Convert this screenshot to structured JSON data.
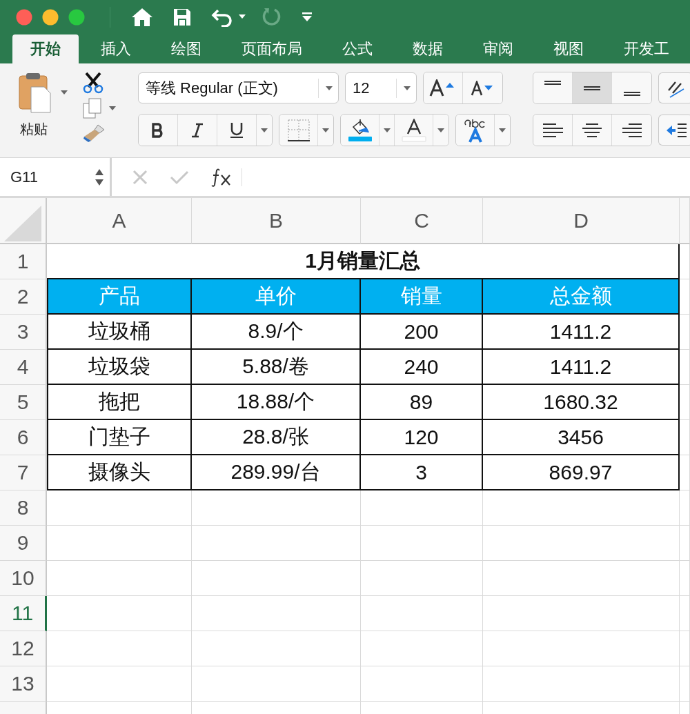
{
  "tabs": [
    {
      "label": "开始",
      "selected": true
    },
    {
      "label": "插入",
      "selected": false
    },
    {
      "label": "绘图",
      "selected": false
    },
    {
      "label": "页面布局",
      "selected": false
    },
    {
      "label": "公式",
      "selected": false
    },
    {
      "label": "数据",
      "selected": false
    },
    {
      "label": "审阅",
      "selected": false
    },
    {
      "label": "视图",
      "selected": false
    },
    {
      "label": "开发工",
      "selected": false
    }
  ],
  "ribbon": {
    "paste_label": "粘贴",
    "font_name": "等线 Regular (正文)",
    "font_size": "12",
    "vertical_align": [
      {
        "selected": false
      },
      {
        "selected": true
      },
      {
        "selected": false
      }
    ]
  },
  "formula_bar": {
    "name_box": "G11"
  },
  "sheet": {
    "columns": [
      {
        "label": "A"
      },
      {
        "label": "B"
      },
      {
        "label": "C"
      },
      {
        "label": "D"
      }
    ],
    "rows": [
      {
        "number": "1",
        "selected": false,
        "kind": "title",
        "cells": [
          "1月销量汇总"
        ]
      },
      {
        "number": "2",
        "selected": false,
        "kind": "header",
        "cells": [
          "产品",
          "单价",
          "销量",
          "总金额"
        ]
      },
      {
        "number": "3",
        "selected": false,
        "kind": "data",
        "cells": [
          "垃圾桶",
          "8.9/个",
          "200",
          "1411.2"
        ]
      },
      {
        "number": "4",
        "selected": false,
        "kind": "data",
        "cells": [
          "垃圾袋",
          "5.88/卷",
          "240",
          "1411.2"
        ]
      },
      {
        "number": "5",
        "selected": false,
        "kind": "data",
        "cells": [
          "拖把",
          "18.88/个",
          "89",
          "1680.32"
        ]
      },
      {
        "number": "6",
        "selected": false,
        "kind": "data",
        "cells": [
          "门垫子",
          "28.8/张",
          "120",
          "3456"
        ]
      },
      {
        "number": "7",
        "selected": false,
        "kind": "data",
        "cells": [
          "摄像头",
          "289.99/台",
          "3",
          "869.97"
        ]
      },
      {
        "number": "8",
        "selected": false,
        "kind": "empty"
      },
      {
        "number": "9",
        "selected": false,
        "kind": "empty"
      },
      {
        "number": "10",
        "selected": false,
        "kind": "empty"
      },
      {
        "number": "11",
        "selected": true,
        "kind": "empty"
      },
      {
        "number": "12",
        "selected": false,
        "kind": "empty"
      },
      {
        "number": "13",
        "selected": false,
        "kind": "empty"
      },
      {
        "selected": false,
        "kind": "empty"
      }
    ]
  }
}
